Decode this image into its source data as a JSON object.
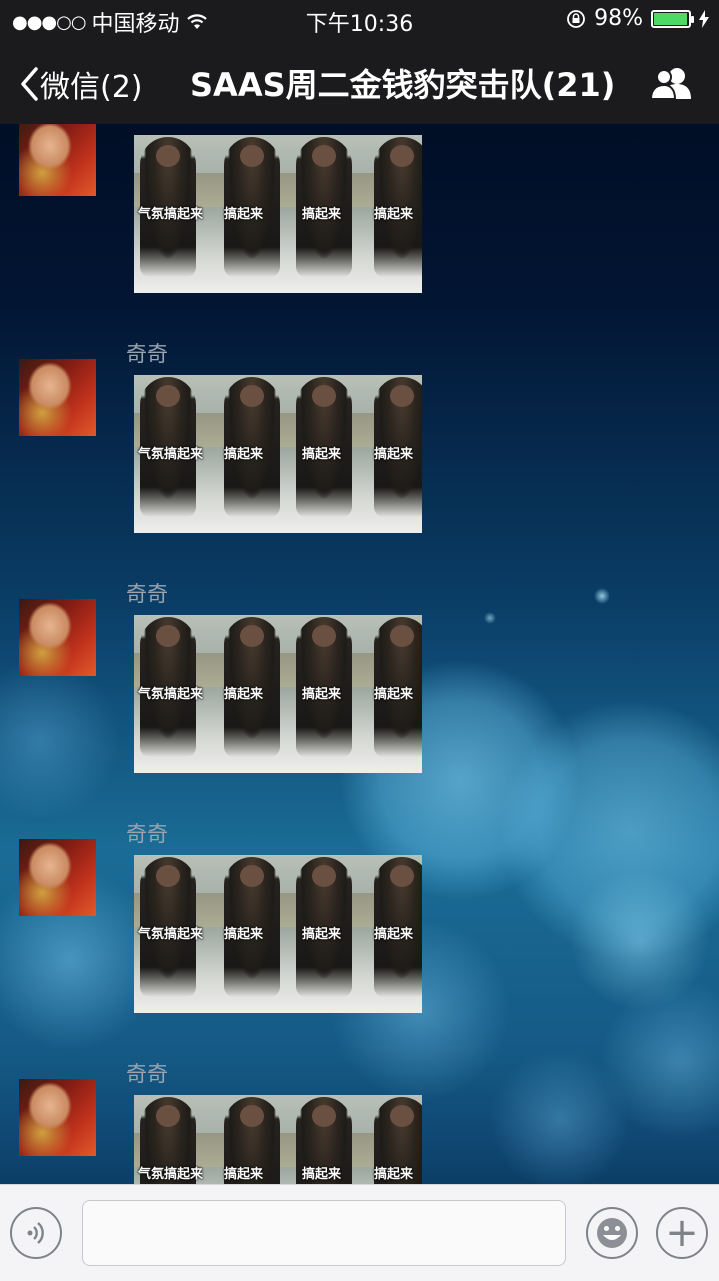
{
  "status_bar": {
    "signal": "●●●○○",
    "carrier": "中国移动",
    "time": "下午10:36",
    "battery_percent": "98%",
    "battery_level": 0.98,
    "battery_color": "#4cd964"
  },
  "nav": {
    "back_label": "微信(2)",
    "title": "SAAS周二金钱豹突击队(21)",
    "group_icon": "group-members-icon"
  },
  "messages": [
    {
      "sender": "",
      "sticker_captions": [
        "气氛搞起来",
        "搞起来",
        "搞起来",
        "搞起来"
      ]
    },
    {
      "sender": "奇奇",
      "sticker_captions": [
        "气氛搞起来",
        "搞起来",
        "搞起来",
        "搞起来"
      ]
    },
    {
      "sender": "奇奇",
      "sticker_captions": [
        "气氛搞起来",
        "搞起来",
        "搞起来",
        "搞起来"
      ]
    },
    {
      "sender": "奇奇",
      "sticker_captions": [
        "气氛搞起来",
        "搞起来",
        "搞起来",
        "搞起来"
      ]
    },
    {
      "sender": "奇奇",
      "sticker_captions": [
        "气氛搞起来",
        "搞起来",
        "搞起来",
        "搞起来"
      ]
    }
  ],
  "input_bar": {
    "voice_icon": "voice-icon",
    "emoji_icon": "emoji-icon",
    "plus_icon": "plus-icon",
    "plus_glyph": "+",
    "input_value": ""
  }
}
